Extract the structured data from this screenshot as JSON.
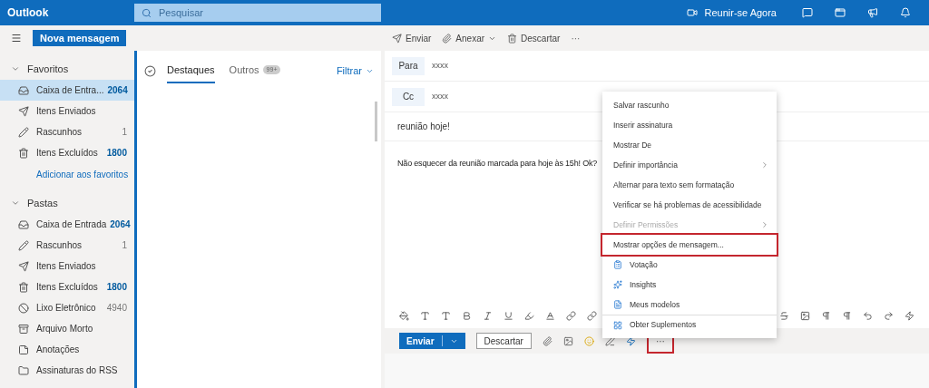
{
  "header": {
    "app_name": "Outlook",
    "search_placeholder": "Pesquisar",
    "meet_now": "Reunir-se Agora"
  },
  "command_bar": {
    "new_message": "Nova mensagem",
    "actions": [
      {
        "kind": "send",
        "label": "Enviar"
      },
      {
        "kind": "attach",
        "label": "Anexar"
      },
      {
        "kind": "discard",
        "label": "Descartar"
      }
    ],
    "more": "···"
  },
  "sidebar": {
    "sections": [
      {
        "title": "Favoritos",
        "expanded": true,
        "items": [
          {
            "kind": "inbox",
            "label": "Caixa de Entra...",
            "count": "2064",
            "unread": true,
            "selected": true
          },
          {
            "kind": "sent",
            "label": "Itens Enviados",
            "selected": false
          },
          {
            "kind": "drafts",
            "label": "Rascunhos",
            "count": "1",
            "unread": false,
            "selected": false
          },
          {
            "kind": "deleted",
            "label": "Itens Excluídos",
            "count": "1800",
            "unread": true,
            "selected": false
          }
        ],
        "footer_link": "Adicionar aos favoritos"
      },
      {
        "title": "Pastas",
        "expanded": true,
        "items": [
          {
            "kind": "inbox",
            "label": "Caixa de Entrada",
            "count": "2064",
            "unread": true,
            "selected": false
          },
          {
            "kind": "drafts",
            "label": "Rascunhos",
            "count": "1",
            "unread": false,
            "selected": false
          },
          {
            "kind": "sent",
            "label": "Itens Enviados",
            "selected": false
          },
          {
            "kind": "deleted",
            "label": "Itens Excluídos",
            "count": "1800",
            "unread": true,
            "selected": false
          },
          {
            "kind": "junk",
            "label": "Lixo Eletrônico",
            "count": "4940",
            "unread": false,
            "selected": false
          },
          {
            "kind": "archive",
            "label": "Arquivo Morto",
            "selected": false
          },
          {
            "kind": "notes",
            "label": "Anotações",
            "selected": false
          },
          {
            "kind": "folder",
            "label": "Assinaturas do RSS",
            "selected": false
          }
        ]
      }
    ]
  },
  "message_list": {
    "tabs": [
      {
        "label": "Destaques",
        "selected": true
      },
      {
        "label": "Outros",
        "badge": "99+",
        "selected": false
      }
    ],
    "filter": "Filtrar"
  },
  "compose": {
    "to_label": "Para",
    "to_value": "xxxx",
    "cc_label": "Cc",
    "cc_value": "xxxx",
    "subject": "reunião hoje!",
    "body": "Não esquecer da reunião marcada para hoje às 15h! Ok?",
    "send": "Enviar",
    "discard": "Descartar",
    "more": "···",
    "more_highlighted": true
  },
  "context_menu": {
    "items": [
      {
        "kind": "text",
        "label": "Salvar rascunho",
        "disabled": false,
        "submenu": false,
        "highlighted": false
      },
      {
        "kind": "text",
        "label": "Inserir assinatura",
        "disabled": false,
        "submenu": false,
        "highlighted": false
      },
      {
        "kind": "text",
        "label": "Mostrar De",
        "disabled": false,
        "submenu": false,
        "highlighted": false
      },
      {
        "kind": "text",
        "label": "Definir importância",
        "disabled": false,
        "submenu": true,
        "highlighted": false
      },
      {
        "kind": "text",
        "label": "Alternar para texto sem formatação",
        "disabled": false,
        "submenu": false,
        "highlighted": false
      },
      {
        "kind": "text",
        "label": "Verificar se há problemas de acessibilidade",
        "disabled": false,
        "submenu": false,
        "highlighted": false
      },
      {
        "kind": "text",
        "label": "Definir Permissões",
        "disabled": true,
        "submenu": true,
        "highlighted": false
      },
      {
        "kind": "text",
        "label": "Mostrar opções de mensagem...",
        "disabled": false,
        "submenu": false,
        "highlighted": true
      },
      {
        "kind": "poll",
        "label": "Votação",
        "disabled": false,
        "submenu": false,
        "highlighted": false
      },
      {
        "kind": "insights",
        "label": "Insights",
        "disabled": false,
        "submenu": false,
        "highlighted": false
      },
      {
        "kind": "templates",
        "label": "Meus modelos",
        "disabled": false,
        "submenu": false,
        "highlighted": false
      },
      {
        "kind": "addins",
        "label": "Obter Suplementos",
        "disabled": false,
        "submenu": false,
        "highlighted": false
      }
    ]
  }
}
